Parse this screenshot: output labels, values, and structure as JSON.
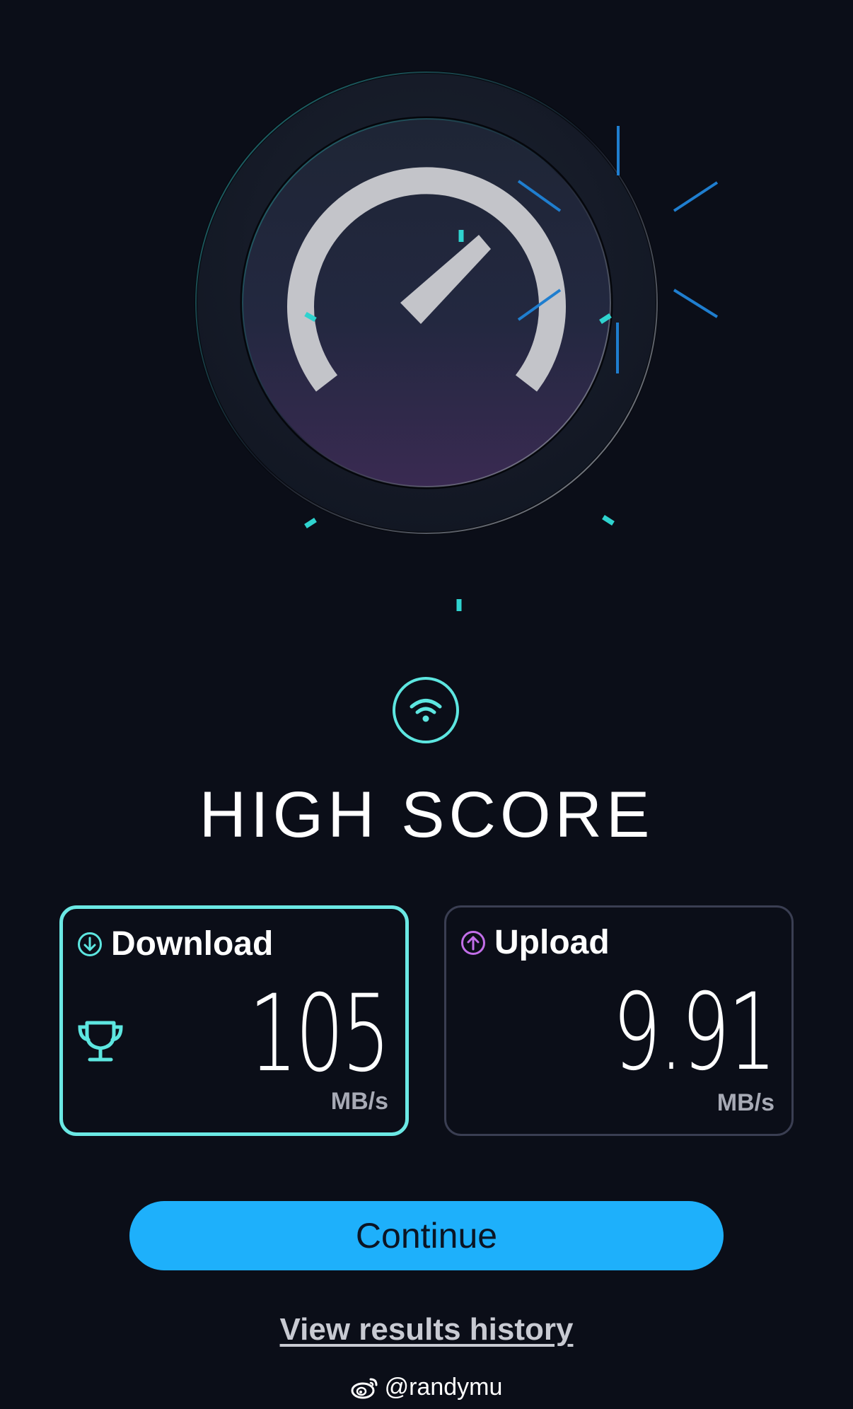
{
  "title": "HIGH SCORE",
  "download": {
    "label": "Download",
    "value": "105",
    "unit": "MB/s"
  },
  "upload": {
    "label": "Upload",
    "value": "9.91",
    "unit": "MB/s"
  },
  "continue_label": "Continue",
  "history_label": "View results history",
  "watermark": "@randymu",
  "colors": {
    "background": "#0b0e18",
    "accent": "#5de6e0",
    "button": "#1eb0fb",
    "upload_icon": "#c26ee8"
  },
  "icons": [
    "speedometer-icon",
    "wifi-icon",
    "download-arrow-icon",
    "upload-arrow-icon",
    "trophy-icon",
    "weibo-icon"
  ]
}
